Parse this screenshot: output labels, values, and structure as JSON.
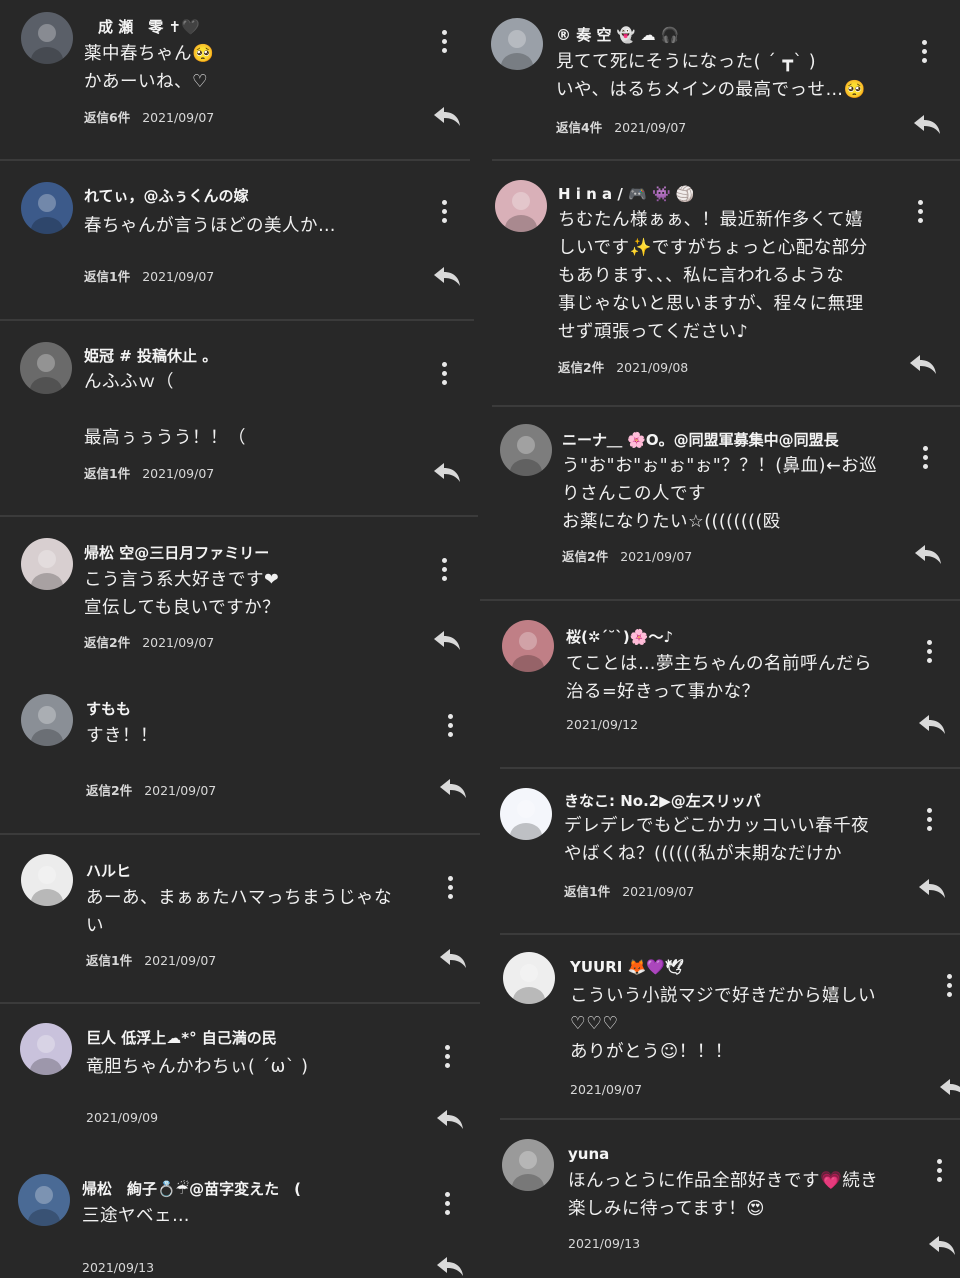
{
  "colors": {
    "background": "#282828",
    "divider": "#3b3b3b",
    "text": "#f0f0f0",
    "icon": "#d9d9d9"
  },
  "icons": {
    "more": "more-vertical-icon",
    "reply": "reply-arrow-icon"
  },
  "left_comments": [
    {
      "username": "成 瀬　零 ✝🖤",
      "text": "薬中春ちゃん🥺\nかあーいね、♡",
      "replies": "返信6件",
      "date": "2021/09/07",
      "avatar_color": "#5a5f68"
    },
    {
      "username": "れてぃ，@ふぅくんの嫁",
      "text": "春ちゃんが言うほどの美人か…",
      "replies": "返信1件",
      "date": "2021/09/07",
      "avatar_color": "#3c5a8a"
    },
    {
      "username": "姫冠 # 投稿休止 。",
      "text": "んふふｗ（\n\n最高ぅぅうう！！（",
      "replies": "返信1件",
      "date": "2021/09/07",
      "avatar_color": "#6a6a6a"
    },
    {
      "username": "帰松 空@三日月ファミリー",
      "text": "こう言う系大好きです❤︎\n宣伝しても良いですか？",
      "replies": "返信2件",
      "date": "2021/09/07",
      "avatar_color": "#d8cfd0"
    },
    {
      "username": "すもも",
      "text": "すき！！",
      "replies": "返信2件",
      "date": "2021/09/07",
      "avatar_color": "#8a8f96"
    },
    {
      "username": "ハルヒ",
      "text": "あーあ、まぁぁたハマっちまうじゃな\nい",
      "replies": "返信1件",
      "date": "2021/09/07",
      "avatar_color": "#ececec"
    },
    {
      "username": "巨人 低浮上☁*° 自己満の民",
      "text": "竜胆ちゃんかわちぃ( ´ω` )",
      "replies": "",
      "date": "2021/09/09",
      "avatar_color": "#c9c2dc"
    },
    {
      "username": "帰松　絢子💍☔@苗字変えた　(",
      "text": "三途ヤベェ…",
      "replies": "",
      "date": "2021/09/13",
      "avatar_color": "#4a6a95"
    }
  ],
  "right_comments": [
    {
      "username": "® 奏 空 👻 ☁ 🎧",
      "text": "見てて死にそうになった( ´ ┳` )\nいや、はるちメインの最高でっせ…🥺",
      "replies": "返信4件",
      "date": "2021/09/07",
      "avatar_color": "#9aa0a8"
    },
    {
      "username": "H i n a / 🎮 👾 🏐",
      "text": "ちむたん様ぁぁ、！最近新作多くて嬉\nしいです✨ですがちょっと心配な部分\nもあります、、、私に言われるような\n事じゃないと思いますが、程々に無理\nせず頑張ってください♪",
      "replies": "返信2件",
      "date": "2021/09/08",
      "avatar_color": "#d9b0b8"
    },
    {
      "username": "ニーナ＿ 🌸O。@同盟軍募集中@同盟長",
      "text": "う\"お\"お\"ぉ\"ぉ\"ぉ\"？？！(鼻血)←お巡\nりさんこの人です\nお薬になりたい☆((((((((殴",
      "replies": "返信2件",
      "date": "2021/09/07",
      "avatar_color": "#7d7d7d"
    },
    {
      "username": "桜(✲´˘`)🌸〜♪",
      "text": "てことは…夢主ちゃんの名前呼んだら\n治る=好きって事かな？",
      "replies": "",
      "date": "2021/09/12",
      "avatar_color": "#c07f86"
    },
    {
      "username": "きなこ: No.2▶@左スリッパ",
      "text": "デレデレでもどこかカッコいい春千夜\nやばくね？((((((私が末期なだけか",
      "replies": "返信1件",
      "date": "2021/09/07",
      "avatar_color": "#f4f6fb"
    },
    {
      "username": "YUURI 🦊💜🕊",
      "text": "こういう小説マジで好きだから嬉しい\n♡♡♡\nありがとう☺！！！",
      "replies": "",
      "date": "2021/09/07",
      "avatar_color": "#eeeeee"
    },
    {
      "username": "yuna",
      "text": "ほんっとうに作品全部好きです💗続き\n楽しみに待ってます！😍",
      "replies": "",
      "date": "2021/09/13",
      "avatar_color": "#9a9a9a"
    }
  ]
}
